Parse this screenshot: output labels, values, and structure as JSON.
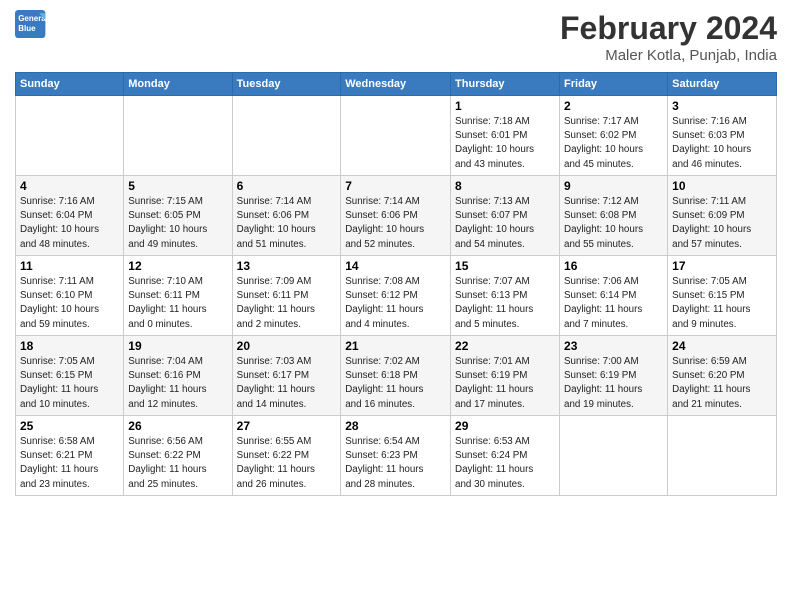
{
  "header": {
    "logo_line1": "General",
    "logo_line2": "Blue",
    "main_title": "February 2024",
    "sub_title": "Maler Kotla, Punjab, India"
  },
  "weekdays": [
    "Sunday",
    "Monday",
    "Tuesday",
    "Wednesday",
    "Thursday",
    "Friday",
    "Saturday"
  ],
  "weeks": [
    [
      {
        "day": "",
        "info": ""
      },
      {
        "day": "",
        "info": ""
      },
      {
        "day": "",
        "info": ""
      },
      {
        "day": "",
        "info": ""
      },
      {
        "day": "1",
        "info": "Sunrise: 7:18 AM\nSunset: 6:01 PM\nDaylight: 10 hours\nand 43 minutes."
      },
      {
        "day": "2",
        "info": "Sunrise: 7:17 AM\nSunset: 6:02 PM\nDaylight: 10 hours\nand 45 minutes."
      },
      {
        "day": "3",
        "info": "Sunrise: 7:16 AM\nSunset: 6:03 PM\nDaylight: 10 hours\nand 46 minutes."
      }
    ],
    [
      {
        "day": "4",
        "info": "Sunrise: 7:16 AM\nSunset: 6:04 PM\nDaylight: 10 hours\nand 48 minutes."
      },
      {
        "day": "5",
        "info": "Sunrise: 7:15 AM\nSunset: 6:05 PM\nDaylight: 10 hours\nand 49 minutes."
      },
      {
        "day": "6",
        "info": "Sunrise: 7:14 AM\nSunset: 6:06 PM\nDaylight: 10 hours\nand 51 minutes."
      },
      {
        "day": "7",
        "info": "Sunrise: 7:14 AM\nSunset: 6:06 PM\nDaylight: 10 hours\nand 52 minutes."
      },
      {
        "day": "8",
        "info": "Sunrise: 7:13 AM\nSunset: 6:07 PM\nDaylight: 10 hours\nand 54 minutes."
      },
      {
        "day": "9",
        "info": "Sunrise: 7:12 AM\nSunset: 6:08 PM\nDaylight: 10 hours\nand 55 minutes."
      },
      {
        "day": "10",
        "info": "Sunrise: 7:11 AM\nSunset: 6:09 PM\nDaylight: 10 hours\nand 57 minutes."
      }
    ],
    [
      {
        "day": "11",
        "info": "Sunrise: 7:11 AM\nSunset: 6:10 PM\nDaylight: 10 hours\nand 59 minutes."
      },
      {
        "day": "12",
        "info": "Sunrise: 7:10 AM\nSunset: 6:11 PM\nDaylight: 11 hours\nand 0 minutes."
      },
      {
        "day": "13",
        "info": "Sunrise: 7:09 AM\nSunset: 6:11 PM\nDaylight: 11 hours\nand 2 minutes."
      },
      {
        "day": "14",
        "info": "Sunrise: 7:08 AM\nSunset: 6:12 PM\nDaylight: 11 hours\nand 4 minutes."
      },
      {
        "day": "15",
        "info": "Sunrise: 7:07 AM\nSunset: 6:13 PM\nDaylight: 11 hours\nand 5 minutes."
      },
      {
        "day": "16",
        "info": "Sunrise: 7:06 AM\nSunset: 6:14 PM\nDaylight: 11 hours\nand 7 minutes."
      },
      {
        "day": "17",
        "info": "Sunrise: 7:05 AM\nSunset: 6:15 PM\nDaylight: 11 hours\nand 9 minutes."
      }
    ],
    [
      {
        "day": "18",
        "info": "Sunrise: 7:05 AM\nSunset: 6:15 PM\nDaylight: 11 hours\nand 10 minutes."
      },
      {
        "day": "19",
        "info": "Sunrise: 7:04 AM\nSunset: 6:16 PM\nDaylight: 11 hours\nand 12 minutes."
      },
      {
        "day": "20",
        "info": "Sunrise: 7:03 AM\nSunset: 6:17 PM\nDaylight: 11 hours\nand 14 minutes."
      },
      {
        "day": "21",
        "info": "Sunrise: 7:02 AM\nSunset: 6:18 PM\nDaylight: 11 hours\nand 16 minutes."
      },
      {
        "day": "22",
        "info": "Sunrise: 7:01 AM\nSunset: 6:19 PM\nDaylight: 11 hours\nand 17 minutes."
      },
      {
        "day": "23",
        "info": "Sunrise: 7:00 AM\nSunset: 6:19 PM\nDaylight: 11 hours\nand 19 minutes."
      },
      {
        "day": "24",
        "info": "Sunrise: 6:59 AM\nSunset: 6:20 PM\nDaylight: 11 hours\nand 21 minutes."
      }
    ],
    [
      {
        "day": "25",
        "info": "Sunrise: 6:58 AM\nSunset: 6:21 PM\nDaylight: 11 hours\nand 23 minutes."
      },
      {
        "day": "26",
        "info": "Sunrise: 6:56 AM\nSunset: 6:22 PM\nDaylight: 11 hours\nand 25 minutes."
      },
      {
        "day": "27",
        "info": "Sunrise: 6:55 AM\nSunset: 6:22 PM\nDaylight: 11 hours\nand 26 minutes."
      },
      {
        "day": "28",
        "info": "Sunrise: 6:54 AM\nSunset: 6:23 PM\nDaylight: 11 hours\nand 28 minutes."
      },
      {
        "day": "29",
        "info": "Sunrise: 6:53 AM\nSunset: 6:24 PM\nDaylight: 11 hours\nand 30 minutes."
      },
      {
        "day": "",
        "info": ""
      },
      {
        "day": "",
        "info": ""
      }
    ]
  ]
}
